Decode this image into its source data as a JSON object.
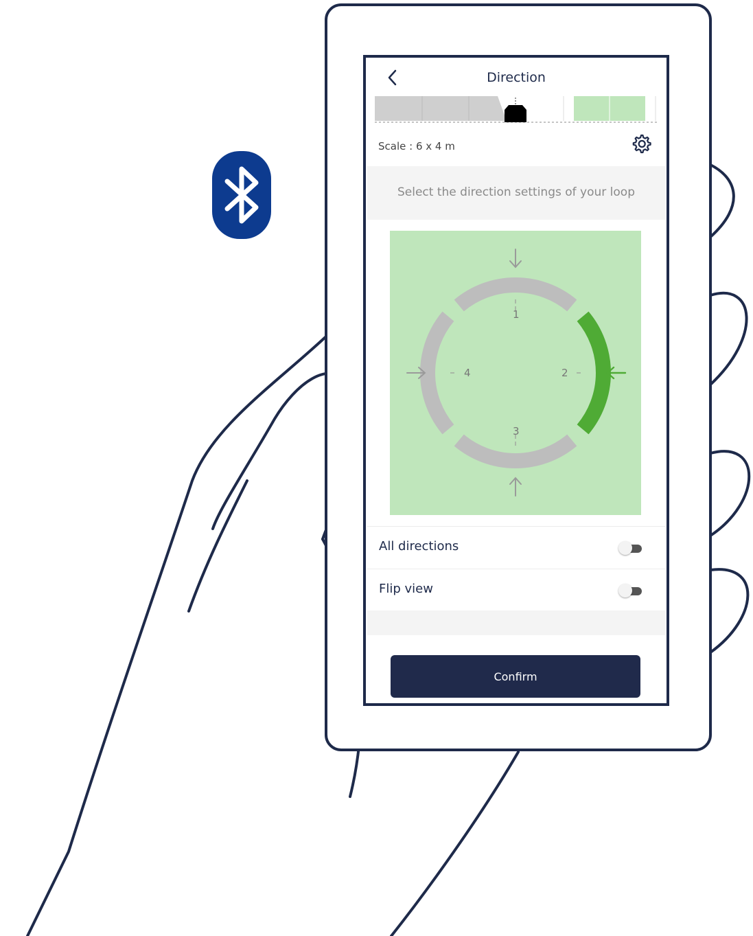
{
  "header": {
    "title": "Direction",
    "back_icon": "chevron-left-icon"
  },
  "scale": {
    "label": "Scale : 6 x 4 m",
    "settings_icon": "gear-icon"
  },
  "hint": "Select the direction settings of your loop",
  "loop": {
    "segments": [
      {
        "label": "1",
        "selected": false
      },
      {
        "label": "2",
        "selected": true
      },
      {
        "label": "3",
        "selected": false
      },
      {
        "label": "4",
        "selected": false
      }
    ]
  },
  "toggles": [
    {
      "label": "All directions",
      "on": false
    },
    {
      "label": "Flip view",
      "on": false
    }
  ],
  "confirm_label": "Confirm",
  "colors": {
    "accent": "#202a4b",
    "selected": "#4fab35",
    "field": "#bfe6bb",
    "segment": "#bdbdbd",
    "bluetooth": "#0d3b8f"
  }
}
